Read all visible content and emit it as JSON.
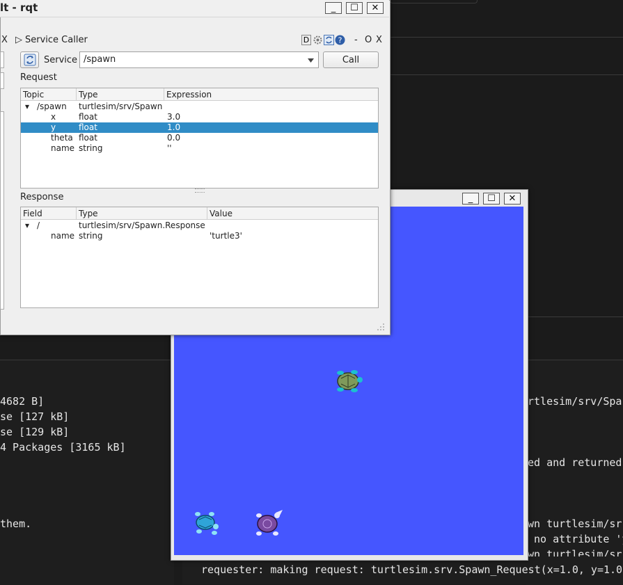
{
  "rqt": {
    "title": "lt - rqt",
    "min_label": "_",
    "max_label": "☐",
    "close_label": "✕",
    "left_dock_close": "X",
    "plugin_title": "Service Caller",
    "plugin_arrow": "▷",
    "dock_icons": {
      "d": "D",
      "min": "-",
      "float": "O",
      "close": "X"
    },
    "service_label": "Service",
    "service_value": "/spawn",
    "call_label": "Call",
    "request_label": "Request",
    "request_headers": [
      "Topic",
      "Type",
      "Expression"
    ],
    "request_rows": [
      {
        "topic": "/spawn",
        "type": "turtlesim/srv/Spawn",
        "expr": "",
        "expander": "▾"
      },
      {
        "topic": "x",
        "type": "float",
        "expr": "3.0"
      },
      {
        "topic": "y",
        "type": "float",
        "expr": "1.0"
      },
      {
        "topic": "theta",
        "type": "float",
        "expr": "0.0"
      },
      {
        "topic": "name",
        "type": "string",
        "expr": "''"
      }
    ],
    "response_label": "Response",
    "response_headers": [
      "Field",
      "Type",
      "Value"
    ],
    "response_rows": [
      {
        "field": "/",
        "type": "turtlesim/srv/Spawn.Response",
        "value": "",
        "expander": "▾"
      },
      {
        "field": "name",
        "type": "string",
        "value": "'turtle3'"
      }
    ]
  },
  "turtlesim": {
    "min_label": "_",
    "max_label": "☐",
    "close_label": "✕",
    "background": "#4556ff"
  },
  "terminal_left": [
    "4682 B]",
    "se [127 kB]",
    "se [129 kB]",
    "4 Packages [3165 kB]",
    "",
    "",
    "",
    "them."
  ],
  "terminal_right": [
    "rtlesim/srv/Spa",
    "",
    "",
    "ed and returned",
    "",
    "",
    "",
    "wn turtlesim/sr",
    " no attribute 'y",
    "wn turtlesim/sr"
  ],
  "terminal_bottom": "requester: making request: turtlesim.srv.Spawn_Request(x=1.0, y=1.0"
}
